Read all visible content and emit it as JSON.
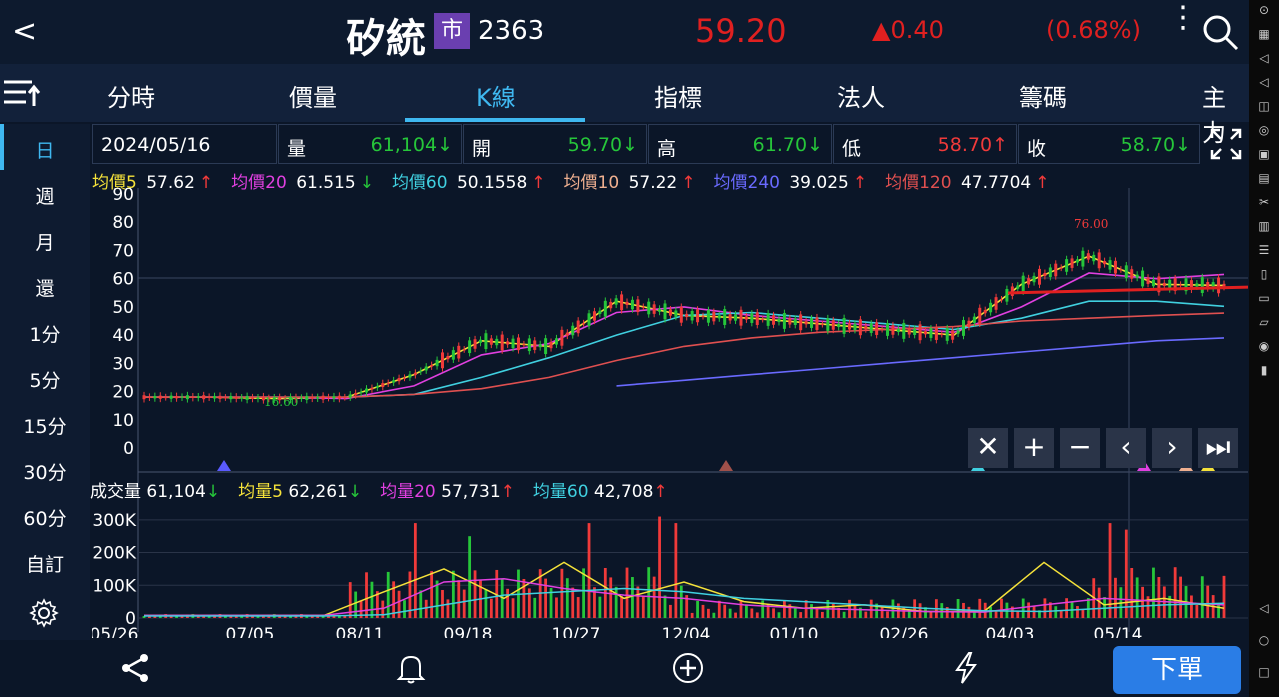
{
  "header": {
    "back": "<",
    "name": "矽統",
    "market": "市",
    "code": "2363",
    "price": "59.20",
    "change": "▲0.40",
    "pct": "(0.68%)"
  },
  "tabs": [
    "分時",
    "價量",
    "K線",
    "指標",
    "法人",
    "籌碼",
    "主力"
  ],
  "active_tab": "K線",
  "periods": [
    "日",
    "週",
    "月",
    "還",
    "1分",
    "5分",
    "15分",
    "30分",
    "60分",
    "自訂"
  ],
  "active_period": "日",
  "info": {
    "date": "2024/05/16",
    "vol_label": "量",
    "vol": "61,104↓",
    "open_label": "開",
    "open": "59.70↓",
    "high_label": "高",
    "high": "61.70↓",
    "low_label": "低",
    "low": "58.70↑",
    "close_label": "收",
    "close": "58.70↓"
  },
  "ma_legend": [
    {
      "label": "均價5",
      "value": "57.62",
      "arrow": "↑",
      "color": "#f5e23a",
      "arrow_color": "#f03a3a"
    },
    {
      "label": "均價20",
      "value": "61.515",
      "arrow": "↓",
      "color": "#e040e0",
      "arrow_color": "#26c63a"
    },
    {
      "label": "均價60",
      "value": "50.1558",
      "arrow": "↑",
      "color": "#40d0e0",
      "arrow_color": "#f03a3a"
    },
    {
      "label": "均價10",
      "value": "57.22",
      "arrow": "↑",
      "color": "#f0b090",
      "arrow_color": "#f03a3a"
    },
    {
      "label": "均價240",
      "value": "39.025",
      "arrow": "↑",
      "color": "#6a6aff",
      "arrow_color": "#f03a3a"
    },
    {
      "label": "均價120",
      "value": "47.7704",
      "arrow": "↑",
      "color": "#e05050",
      "arrow_color": "#f03a3a"
    }
  ],
  "vol_legend": [
    {
      "label": "成交量",
      "value": "61,104",
      "arrow": "↓",
      "color": "#ffffff",
      "arrow_color": "#26c63a"
    },
    {
      "label": "均量5",
      "value": "62,261",
      "arrow": "↓",
      "color": "#f5e23a",
      "arrow_color": "#26c63a"
    },
    {
      "label": "均量20",
      "value": "57,731",
      "arrow": "↑",
      "color": "#e040e0",
      "arrow_color": "#f03a3a"
    },
    {
      "label": "均量60",
      "value": "42,708",
      "arrow": "↑",
      "color": "#40d0e0",
      "arrow_color": "#f03a3a"
    }
  ],
  "chart_data": {
    "type": "line",
    "price_axis_ticks": [
      "90",
      "80",
      "70",
      "60",
      "50",
      "40",
      "30",
      "20",
      "10",
      "0"
    ],
    "volume_axis_ticks": [
      "300K",
      "200K",
      "100K",
      "0"
    ],
    "x_ticks": [
      "05/26",
      "07/05",
      "08/11",
      "09/18",
      "10/27",
      "12/04",
      "01/10",
      "02/26",
      "04/03",
      "05/14"
    ],
    "annotations": [
      "76.00",
      "16.60"
    ],
    "price_ylim": [
      0,
      90
    ],
    "volume_ylim": [
      0,
      330000
    ],
    "series": [
      {
        "name": "均價5",
        "color": "#f5e23a",
        "values": [
          18,
          18,
          17.5,
          18,
          26,
          38,
          36,
          52,
          47,
          46,
          44,
          42,
          40,
          58,
          68,
          58,
          57.6
        ]
      },
      {
        "name": "均價20",
        "color": "#e040e0",
        "values": [
          18,
          18,
          18,
          17.5,
          22,
          33,
          37,
          48,
          50,
          47,
          45,
          43,
          41,
          50,
          62,
          60,
          61.5
        ]
      },
      {
        "name": "均價60",
        "color": "#40d0e0",
        "values": [
          18,
          18,
          18,
          18,
          19,
          25,
          32,
          40,
          47,
          48,
          46,
          44,
          42,
          46,
          52,
          52,
          50.2
        ]
      },
      {
        "name": "均價120",
        "color": "#e05050",
        "values": [
          18,
          18,
          18,
          18,
          19,
          21,
          25,
          31,
          36,
          39,
          41,
          42,
          43,
          45,
          46,
          47,
          47.8
        ]
      },
      {
        "name": "均價240",
        "color": "#6a6aff",
        "values": [
          null,
          null,
          null,
          null,
          null,
          null,
          null,
          22,
          24,
          26,
          28,
          30,
          32,
          34,
          36,
          38,
          39
        ]
      }
    ],
    "controls": [
      "✕",
      "+",
      "−",
      "‹",
      "›",
      "⏭"
    ]
  },
  "bottom": {
    "order": "下單"
  }
}
